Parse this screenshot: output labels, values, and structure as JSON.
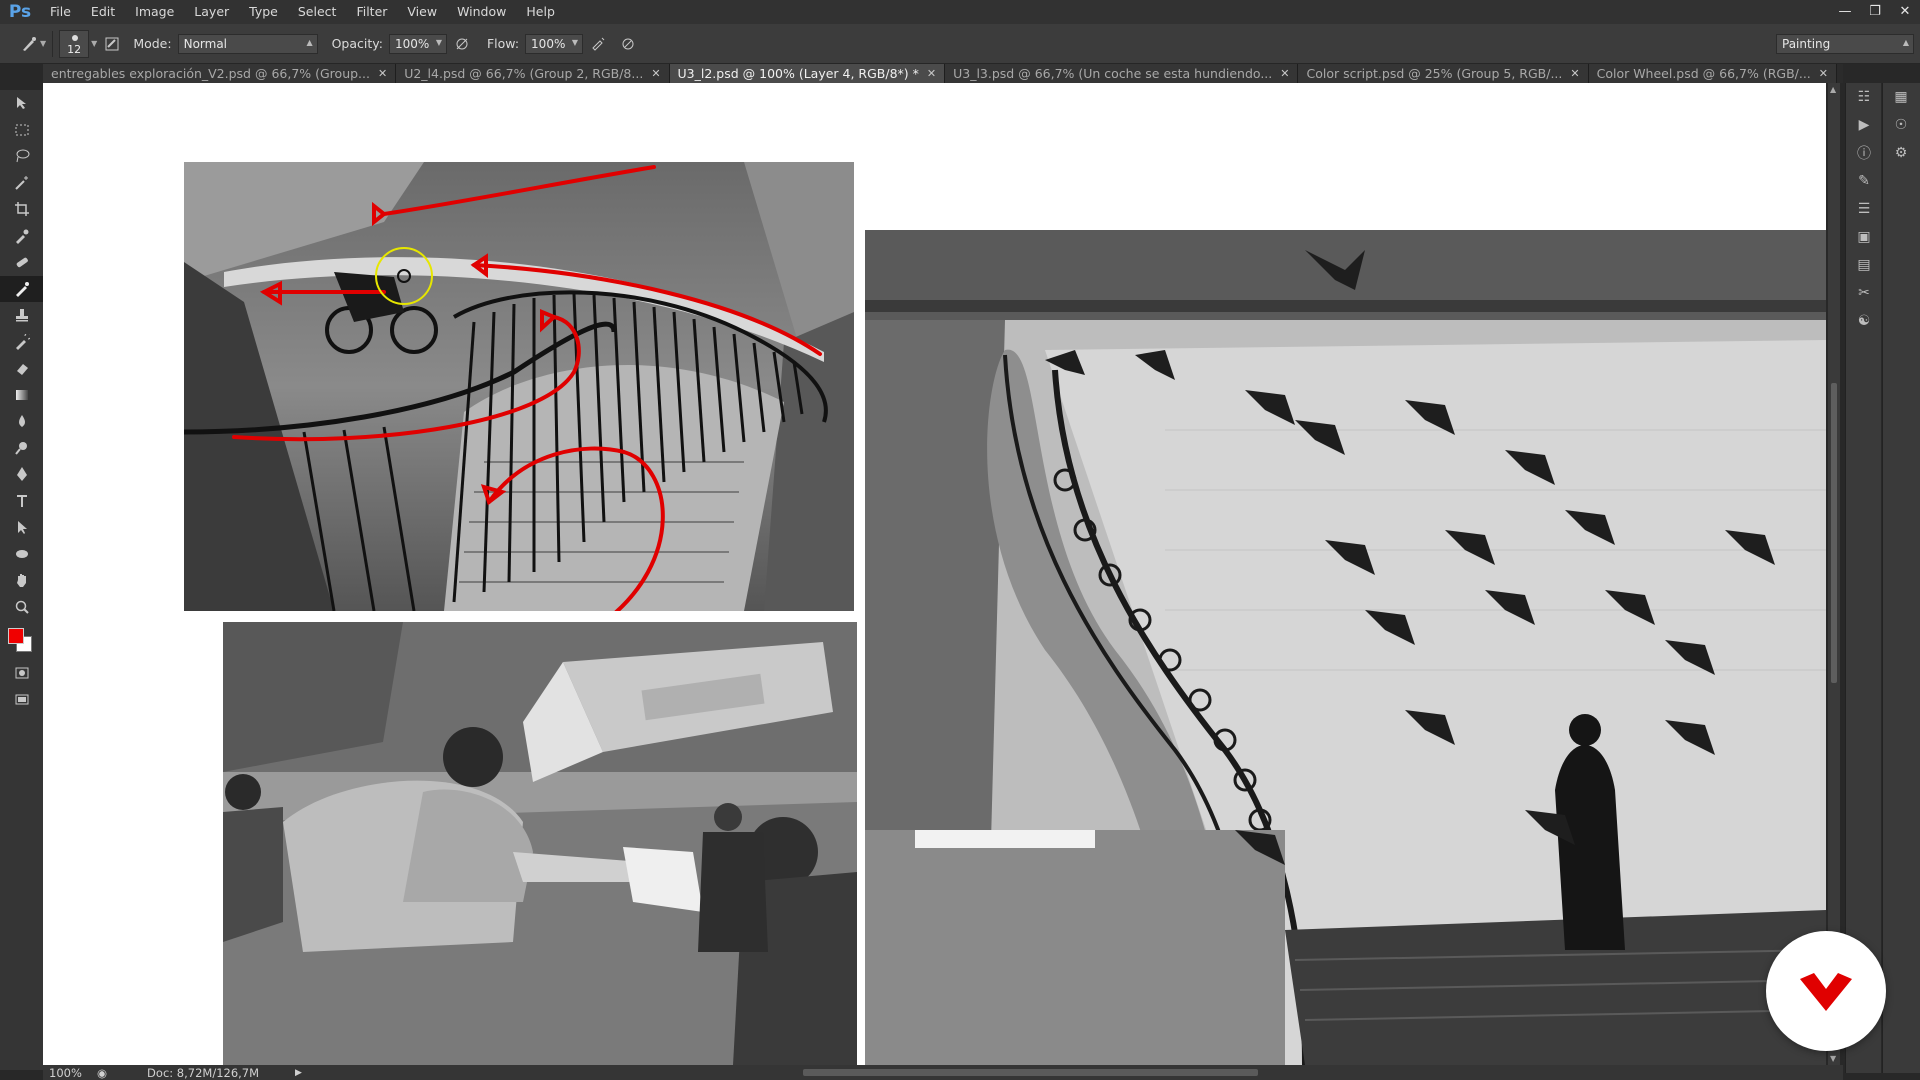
{
  "app": {
    "logo": "Ps"
  },
  "menu": [
    "File",
    "Edit",
    "Image",
    "Layer",
    "Type",
    "Select",
    "Filter",
    "View",
    "Window",
    "Help"
  ],
  "window_controls": [
    "minimize-icon",
    "restore-icon",
    "close-icon"
  ],
  "options": {
    "brush_size": "12",
    "mode_label": "Mode:",
    "mode_value": "Normal",
    "opacity_label": "Opacity:",
    "opacity_value": "100%",
    "flow_label": "Flow:",
    "flow_value": "100%",
    "workspace": "Painting"
  },
  "tabs": [
    {
      "label": "entregables exploración_V2.psd @ 66,7% (Group...",
      "active": false
    },
    {
      "label": "U2_l4.psd @ 66,7% (Group 2, RGB/8...",
      "active": false
    },
    {
      "label": "U3_l2.psd @ 100% (Layer 4, RGB/8*) *",
      "active": true
    },
    {
      "label": "U3_l3.psd @ 66,7% (Un coche se esta hundiendo...",
      "active": false
    },
    {
      "label": "Color script.psd @ 25% (Group 5, RGB/...",
      "active": false
    },
    {
      "label": "Color Wheel.psd @ 66,7% (RGB/...",
      "active": false
    }
  ],
  "tools": [
    "move-icon",
    "marquee-icon",
    "lasso-icon",
    "magic-wand-icon",
    "crop-icon",
    "eyedropper-icon",
    "healing-icon",
    "brush-icon",
    "stamp-icon",
    "history-brush-icon",
    "eraser-icon",
    "gradient-icon",
    "blur-icon",
    "dodge-icon",
    "pen-icon",
    "type-icon",
    "path-select-icon",
    "shape-icon",
    "hand-icon",
    "zoom-icon"
  ],
  "active_tool": "brush-icon",
  "colors": {
    "foreground": "#f00000",
    "background": "#ffffff",
    "brush_stroke": "#e00000",
    "cursor_ring": "#e6e600"
  },
  "status": {
    "zoom": "100%",
    "doc": "Doc: 8,72M/126,7M"
  }
}
